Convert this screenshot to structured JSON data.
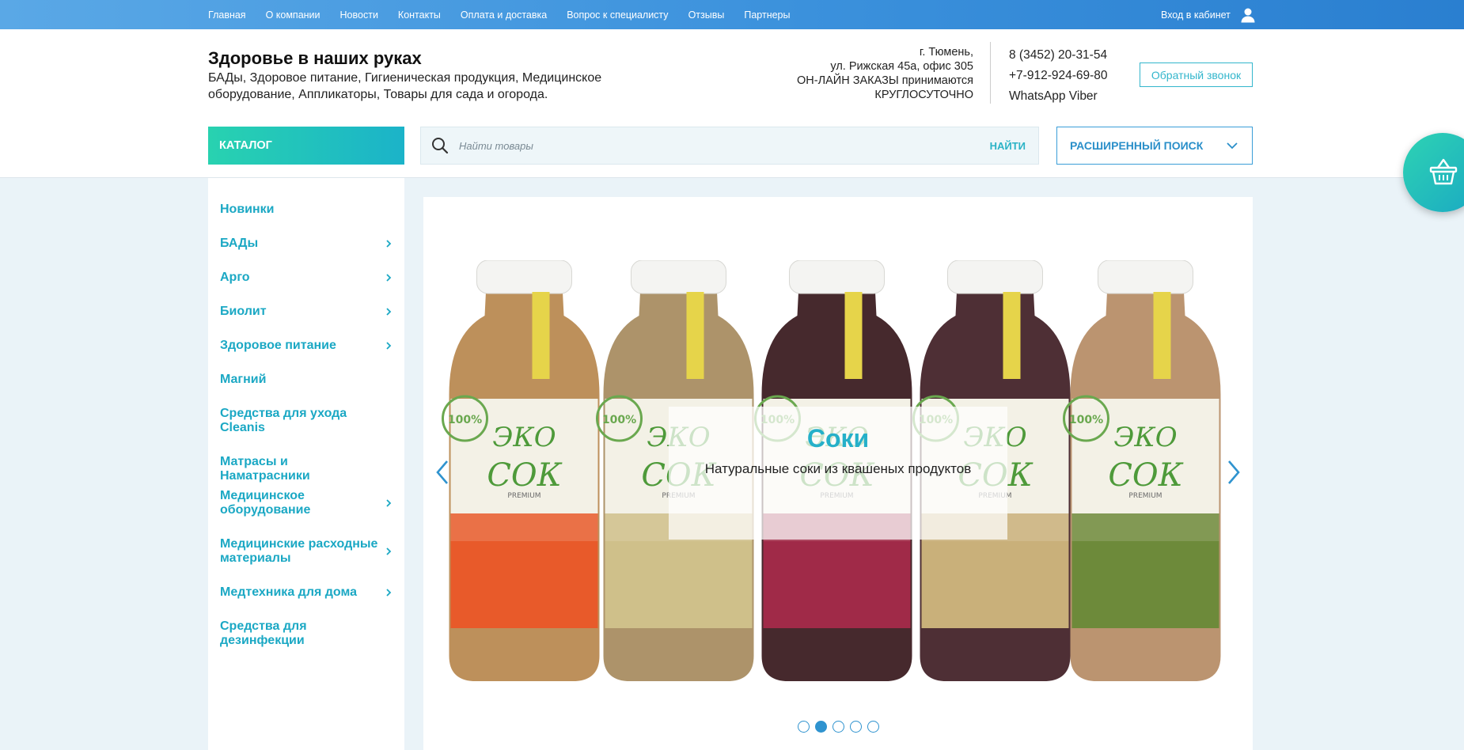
{
  "topnav": {
    "items": [
      "Главная",
      "О компании",
      "Новости",
      "Контакты",
      "Оплата и доставка",
      "Вопрос к специалисту",
      "Отзывы",
      "Партнеры"
    ],
    "login_label": "Вход в кабинет"
  },
  "header": {
    "title": "Здоровье в наших руках",
    "subtitle": "БАДы, Здоровое питание, Гигиеническая продукция, Медицинское оборудование, Аппликаторы, Товары для сада и огорода.",
    "address_lines": [
      "г. Тюмень,",
      "ул. Рижская 45а, офис 305",
      "ОН-ЛАЙН ЗАКАЗЫ принимаются",
      "КРУГЛОСУТОЧНО"
    ],
    "phones": [
      "8 (3452) 20-31-54",
      "+7-912-924-69-80",
      "WhatsApp Viber"
    ],
    "callback_label": "Обратный звонок"
  },
  "toolbar": {
    "catalog_label": "КАТАЛОГ",
    "search_placeholder": "Найти товары",
    "search_button": "НАЙТИ",
    "advanced_search_label": "РАСШИРЕННЫЙ ПОИСК"
  },
  "sidebar": {
    "items": [
      {
        "label": "Новинки",
        "has_children": false
      },
      {
        "label": "БАДы",
        "has_children": true
      },
      {
        "label": "Арго",
        "has_children": true
      },
      {
        "label": "Биолит",
        "has_children": true
      },
      {
        "label": "Здоровое питание",
        "has_children": true
      },
      {
        "label": "Магний",
        "has_children": false
      },
      {
        "label": "Средства для ухода Cleanis",
        "has_children": false
      },
      {
        "label": "Матрасы и Наматрасники",
        "has_children": false
      },
      {
        "label": "Медицинское оборудование",
        "has_children": true
      },
      {
        "label": "Медицинские расходные материалы",
        "has_children": true
      },
      {
        "label": "Медтехника для дома",
        "has_children": true
      },
      {
        "label": "Средства для дезинфекции",
        "has_children": false
      }
    ]
  },
  "slider": {
    "title": "Соки",
    "text": "Натуральные соки из квашеных продуктов",
    "slide_count": 5,
    "active_index": 1,
    "bottle_labels": [
      "ЭКО",
      "СОК",
      "PREMIUM",
      "100%"
    ]
  },
  "colors": {
    "accent_teal": "#1ba8c4",
    "accent_blue": "#2f93cf",
    "topbar_blue": "#3b91dc"
  }
}
